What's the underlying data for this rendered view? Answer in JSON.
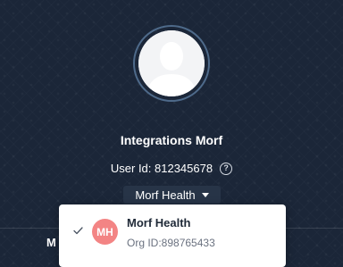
{
  "profile": {
    "name": "Integrations Morf",
    "user_id_label": "User Id: 812345678",
    "help_icon": "question-circle-icon",
    "avatar_icon": "person-silhouette-icon"
  },
  "org_selector": {
    "selected": "Morf Health",
    "caret_icon": "caret-down-icon"
  },
  "org_menu": {
    "items": [
      {
        "initials": "MH",
        "name": "Morf Health",
        "org_id": "Org ID:898765433",
        "selected": true,
        "avatar_color": "#f38484",
        "check_icon": "check-icon"
      }
    ]
  },
  "bottom_bar": {
    "partial_label": "M"
  },
  "colors": {
    "background": "#1b2638",
    "dropdown_bg": "#273447",
    "org_avatar": "#f38484",
    "menu_bg": "#ffffff"
  }
}
